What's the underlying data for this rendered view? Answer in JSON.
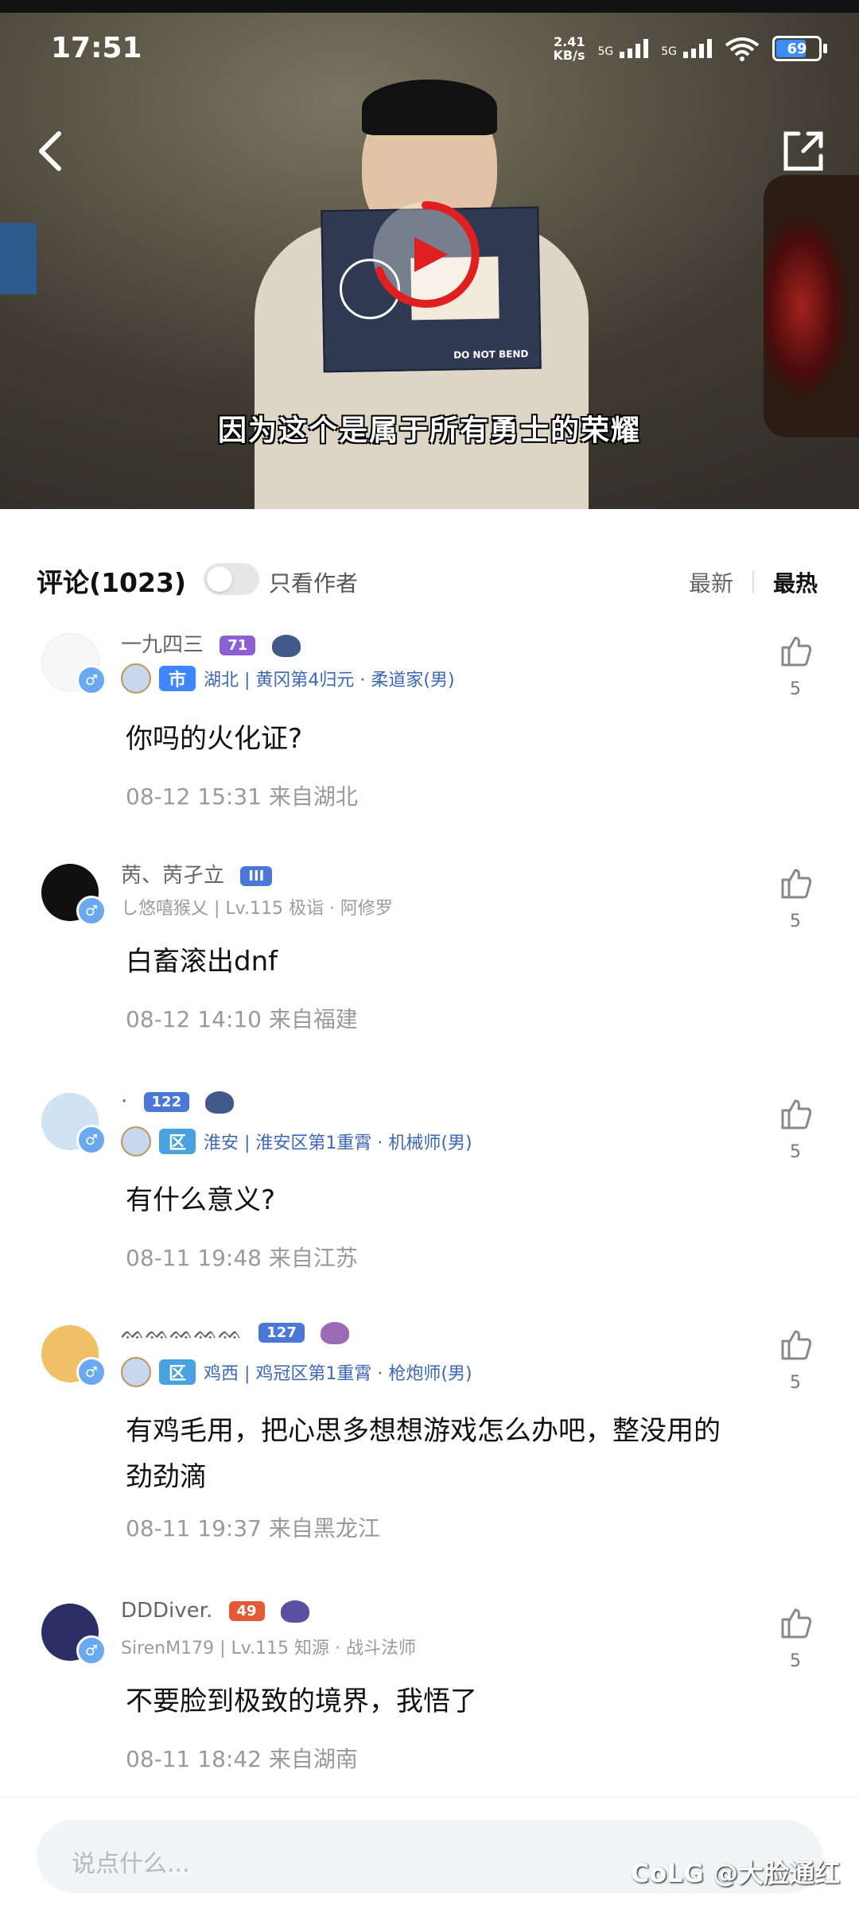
{
  "status_bar": {
    "time": "17:51",
    "net_speed": "2.41\nKB/s",
    "sim1": "5G",
    "sim2": "5G",
    "wifi_sub": "6",
    "battery": "69"
  },
  "video": {
    "subtitle": "因为这个是属于所有勇士的荣耀",
    "cert_label": "DO NOT BEND"
  },
  "comments_header": {
    "title": "评论(1023)",
    "author_only": "只看作者",
    "sort_newest": "最新",
    "sort_hottest": "最热"
  },
  "comments": [
    {
      "name": "一九四三",
      "badge": "71",
      "region_tag": "市",
      "region_text": "湖北 | 黄冈第4归元 · 柔道家(男)",
      "content": "你吗的火化证?",
      "meta": "08-12 15:31  来自湖北",
      "likes": "5"
    },
    {
      "name": "苪、苪孑立",
      "badge": "III",
      "sub_text": "し悠嘻猴乂 | Lv.115 极诣 · 阿修罗",
      "content": "白畜滚出dnf",
      "meta": "08-12 14:10  来自福建",
      "likes": "5"
    },
    {
      "name": "·",
      "badge": "122",
      "region_tag": "区",
      "region_text": "淮安 | 淮安区第1重霄 · 机械师(男)",
      "content": "有什么意义?",
      "meta": "08-11 19:48  来自江苏",
      "likes": "5"
    },
    {
      "name": "ᨐᨐᨐᨐᨐ",
      "badge": "127",
      "region_tag": "区",
      "region_text": "鸡西 | 鸡冠区第1重霄 · 枪炮师(男)",
      "content": "有鸡毛用，把心思多想想游戏怎么办吧，整没用的劲劲滴",
      "meta": "08-11 19:37  来自黑龙江",
      "likes": "5"
    },
    {
      "name": "DDDiver.",
      "badge": "49",
      "sub_text": "SirenM179 | Lv.115 知源 · 战斗法师",
      "content": "不要脸到极致的境界，我悟了",
      "meta": "08-11 18:42  来自湖南",
      "likes": "5"
    }
  ],
  "composer": {
    "placeholder": "说点什么..."
  },
  "watermark": "CoLG @大脸通红"
}
